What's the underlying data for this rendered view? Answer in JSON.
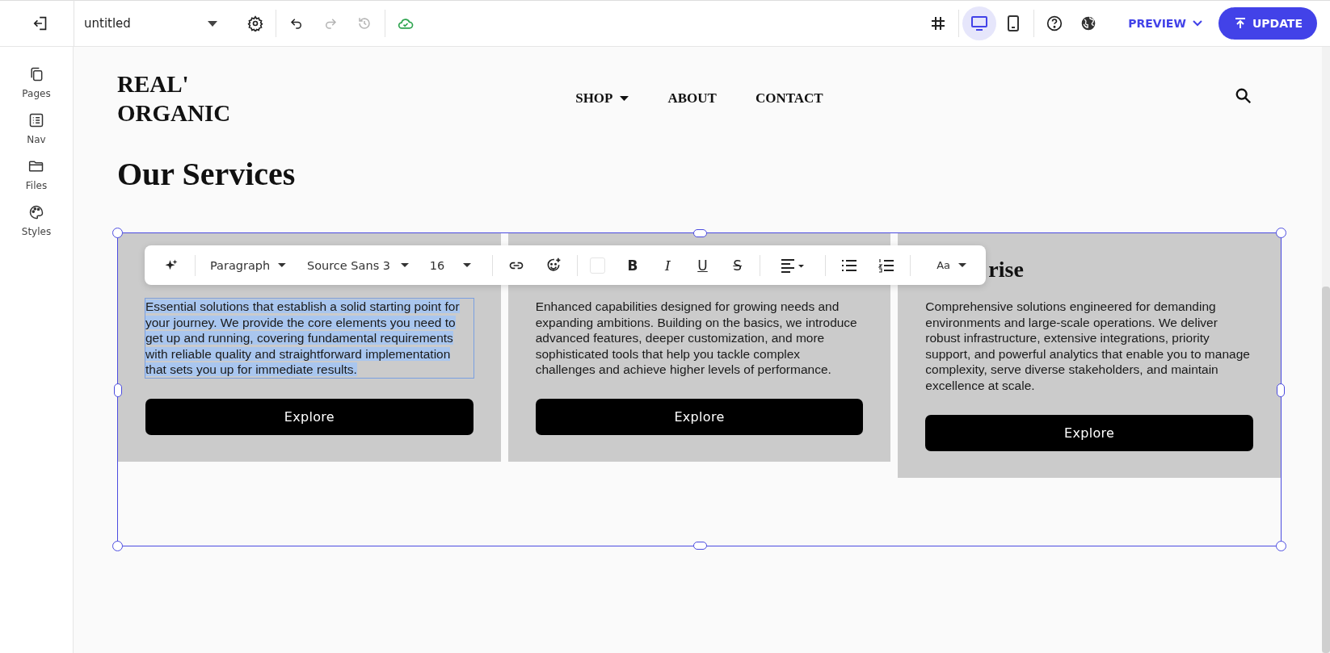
{
  "topbar": {
    "file_name": "untitled",
    "history_tools": [
      {
        "kind": "undo",
        "disabled": false
      },
      {
        "kind": "redo",
        "disabled": true
      },
      {
        "kind": "restore",
        "disabled": true
      }
    ],
    "devices": [
      {
        "kind": "desktop",
        "selected": true
      },
      {
        "kind": "mobile",
        "selected": false
      }
    ],
    "preview": "PREVIEW",
    "update": "UPDATE"
  },
  "sidebar": {
    "items": [
      {
        "kind": "pages",
        "label": "Pages"
      },
      {
        "kind": "nav",
        "label": "Nav"
      },
      {
        "kind": "files",
        "label": "Files"
      },
      {
        "kind": "styles",
        "label": "Styles"
      }
    ]
  },
  "site": {
    "logo": "REAL' ORGANIC",
    "nav": [
      {
        "label": "SHOP",
        "dropdown": true
      },
      {
        "label": "ABOUT",
        "dropdown": false
      },
      {
        "label": "CONTACT",
        "dropdown": false
      }
    ],
    "heading": "Our Services"
  },
  "text_toolbar": {
    "block_style": "Paragraph",
    "font": "Source Sans 3",
    "size": "16",
    "format_buttons": [
      {
        "kind": "bold",
        "label": "B"
      },
      {
        "kind": "italic",
        "label": "I"
      },
      {
        "kind": "underline",
        "label": "U"
      },
      {
        "kind": "strike",
        "label": "S"
      }
    ],
    "text_size": "Aa"
  },
  "cards": [
    {
      "description": "Essential solutions that establish a solid starting point for your journey. We provide the core elements you need to get up and running, covering fundamental requirements with reliable quality and straightforward implementation that sets you up for immediate results.",
      "selected": true,
      "button": "Explore"
    },
    {
      "description": "Enhanced capabilities designed for growing needs and expanding ambitions. Building on the basics, we introduce advanced features, deeper customization, and more sophisticated tools that help you tackle complex challenges and achieve higher levels of performance.",
      "selected": false,
      "button": "Explore"
    },
    {
      "title": "rise",
      "description": "Comprehensive solutions engineered for demanding environments and large-scale operations. We deliver robust infrastructure, extensive integrations, priority support, and powerful analytics that enable you to manage complexity, serve diverse stakeholders, and maintain excellence at scale.",
      "selected": false,
      "button": "Explore"
    }
  ]
}
